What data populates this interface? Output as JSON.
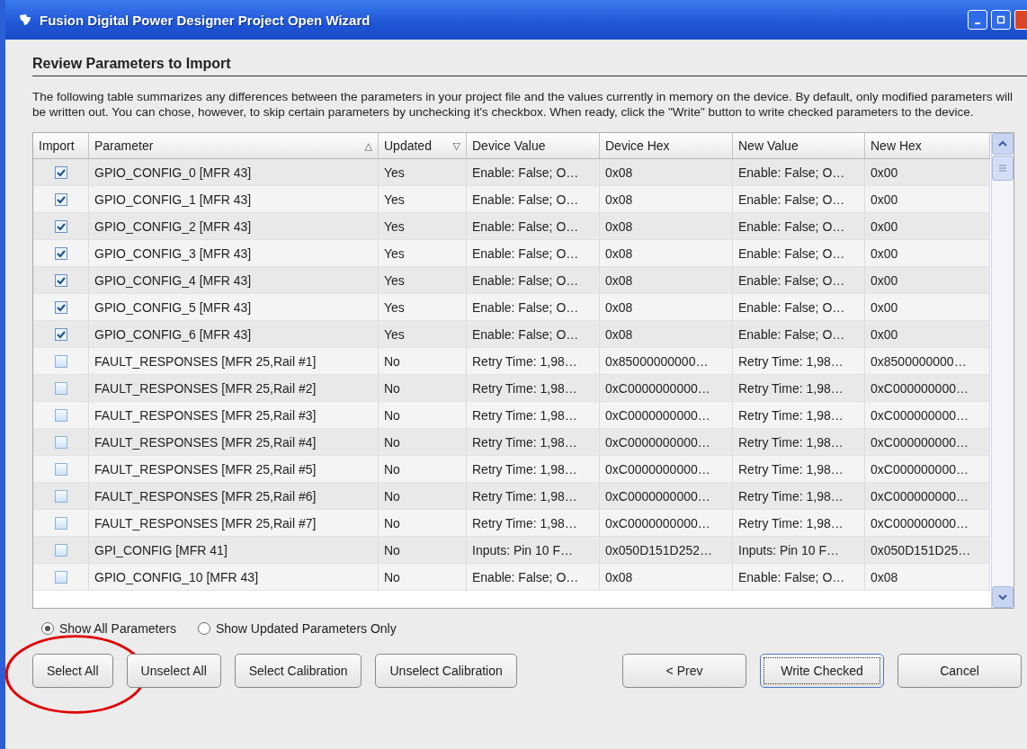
{
  "window": {
    "title": "Fusion Digital Power Designer Project Open Wizard"
  },
  "heading": "Review Parameters to Import",
  "description": "The following table summarizes any differences between the parameters in your project file and the values currently in memory on the device. By default, only modified parameters will be written out. You can chose, however, to skip certain parameters by unchecking it's checkbox. When ready, click the \"Write\" button to write checked parameters to the device.",
  "table": {
    "columns": [
      {
        "label": "Import"
      },
      {
        "label": "Parameter",
        "sort_glyph": "△"
      },
      {
        "label": "Updated",
        "sort_glyph": "▽"
      },
      {
        "label": "Device Value"
      },
      {
        "label": "Device Hex"
      },
      {
        "label": "New Value"
      },
      {
        "label": "New Hex"
      }
    ],
    "rows": [
      {
        "import": true,
        "parameter": "GPIO_CONFIG_0 [MFR 43]",
        "updated": "Yes",
        "device_value": "Enable: False; O…",
        "device_hex": "0x08",
        "new_value": "Enable: False; O…",
        "new_hex": "0x00"
      },
      {
        "import": true,
        "parameter": "GPIO_CONFIG_1 [MFR 43]",
        "updated": "Yes",
        "device_value": "Enable: False; O…",
        "device_hex": "0x08",
        "new_value": "Enable: False; O…",
        "new_hex": "0x00"
      },
      {
        "import": true,
        "parameter": "GPIO_CONFIG_2 [MFR 43]",
        "updated": "Yes",
        "device_value": "Enable: False; O…",
        "device_hex": "0x08",
        "new_value": "Enable: False; O…",
        "new_hex": "0x00"
      },
      {
        "import": true,
        "parameter": "GPIO_CONFIG_3 [MFR 43]",
        "updated": "Yes",
        "device_value": "Enable: False; O…",
        "device_hex": "0x08",
        "new_value": "Enable: False; O…",
        "new_hex": "0x00"
      },
      {
        "import": true,
        "parameter": "GPIO_CONFIG_4 [MFR 43]",
        "updated": "Yes",
        "device_value": "Enable: False; O…",
        "device_hex": "0x08",
        "new_value": "Enable: False; O…",
        "new_hex": "0x00"
      },
      {
        "import": true,
        "parameter": "GPIO_CONFIG_5 [MFR 43]",
        "updated": "Yes",
        "device_value": "Enable: False; O…",
        "device_hex": "0x08",
        "new_value": "Enable: False; O…",
        "new_hex": "0x00"
      },
      {
        "import": true,
        "parameter": "GPIO_CONFIG_6 [MFR 43]",
        "updated": "Yes",
        "device_value": "Enable: False; O…",
        "device_hex": "0x08",
        "new_value": "Enable: False; O…",
        "new_hex": "0x00"
      },
      {
        "import": false,
        "parameter": "FAULT_RESPONSES [MFR 25,Rail #1]",
        "updated": "No",
        "device_value": "Retry Time: 1,98…",
        "device_hex": "0x85000000000…",
        "new_value": "Retry Time: 1,98…",
        "new_hex": "0x8500000000…"
      },
      {
        "import": false,
        "parameter": "FAULT_RESPONSES [MFR 25,Rail #2]",
        "updated": "No",
        "device_value": "Retry Time: 1,98…",
        "device_hex": "0xC0000000000…",
        "new_value": "Retry Time: 1,98…",
        "new_hex": "0xC000000000…"
      },
      {
        "import": false,
        "parameter": "FAULT_RESPONSES [MFR 25,Rail #3]",
        "updated": "No",
        "device_value": "Retry Time: 1,98…",
        "device_hex": "0xC0000000000…",
        "new_value": "Retry Time: 1,98…",
        "new_hex": "0xC000000000…"
      },
      {
        "import": false,
        "parameter": "FAULT_RESPONSES [MFR 25,Rail #4]",
        "updated": "No",
        "device_value": "Retry Time: 1,98…",
        "device_hex": "0xC0000000000…",
        "new_value": "Retry Time: 1,98…",
        "new_hex": "0xC000000000…"
      },
      {
        "import": false,
        "parameter": "FAULT_RESPONSES [MFR 25,Rail #5]",
        "updated": "No",
        "device_value": "Retry Time: 1,98…",
        "device_hex": "0xC0000000000…",
        "new_value": "Retry Time: 1,98…",
        "new_hex": "0xC000000000…"
      },
      {
        "import": false,
        "parameter": "FAULT_RESPONSES [MFR 25,Rail #6]",
        "updated": "No",
        "device_value": "Retry Time: 1,98…",
        "device_hex": "0xC0000000000…",
        "new_value": "Retry Time: 1,98…",
        "new_hex": "0xC000000000…"
      },
      {
        "import": false,
        "parameter": "FAULT_RESPONSES [MFR 25,Rail #7]",
        "updated": "No",
        "device_value": "Retry Time: 1,98…",
        "device_hex": "0xC0000000000…",
        "new_value": "Retry Time: 1,98…",
        "new_hex": "0xC000000000…"
      },
      {
        "import": false,
        "parameter": "GPI_CONFIG [MFR 41]",
        "updated": "No",
        "device_value": "Inputs: Pin 10 F…",
        "device_hex": "0x050D151D252…",
        "new_value": "Inputs: Pin 10 F…",
        "new_hex": "0x050D151D25…"
      },
      {
        "import": false,
        "parameter": "GPIO_CONFIG_10 [MFR 43]",
        "updated": "No",
        "device_value": "Enable: False; O…",
        "device_hex": "0x08",
        "new_value": "Enable: False; O…",
        "new_hex": "0x08"
      }
    ]
  },
  "filter_options": [
    {
      "label": "Show All Parameters",
      "selected": true
    },
    {
      "label": "Show Updated Parameters Only",
      "selected": false
    }
  ],
  "left_buttons": [
    {
      "label": "Select All",
      "circled": true
    },
    {
      "label": "Unselect All",
      "circled": false
    },
    {
      "label": "Select Calibration",
      "circled": false
    },
    {
      "label": "Unselect Calibration",
      "circled": false
    }
  ],
  "right_buttons": [
    {
      "label": "< Prev",
      "focused": false
    },
    {
      "label": "Write Checked",
      "focused": true
    },
    {
      "label": "Cancel",
      "focused": false
    }
  ]
}
